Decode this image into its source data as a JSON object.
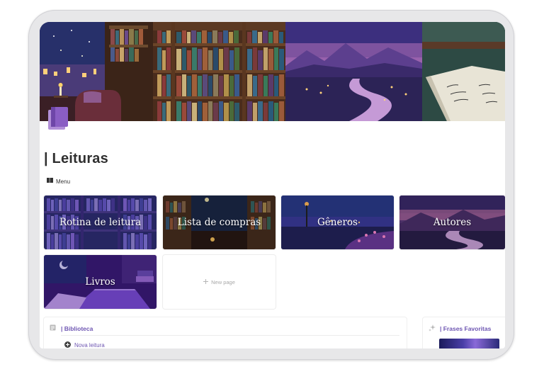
{
  "page": {
    "title": "| Leituras",
    "menu_label": "Menu"
  },
  "cards": [
    {
      "label": "Rotina de leitura"
    },
    {
      "label": "Lista de compras"
    },
    {
      "label": "Gêneros"
    },
    {
      "label": "Autores"
    },
    {
      "label": "Livros"
    }
  ],
  "new_page_label": "New page",
  "biblioteca": {
    "title": "| Biblioteca",
    "new_item": "Nova leitura"
  },
  "frases": {
    "title": "| Frases Favoritas"
  },
  "colors": {
    "accent": "#6e56b2",
    "title_text": "#2f2f2f"
  }
}
